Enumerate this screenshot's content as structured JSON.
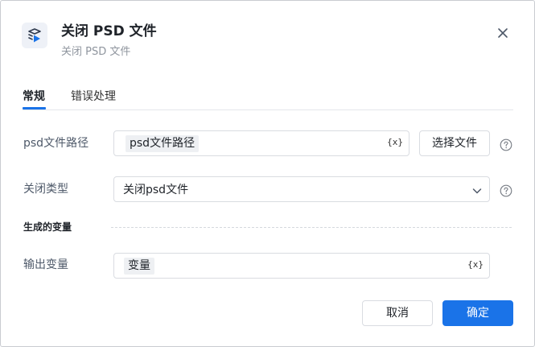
{
  "dialog": {
    "title": "关闭 PSD 文件",
    "subtitle": "关闭 PSD 文件",
    "icon": "psd-stack-icon",
    "close_icon": "close-icon"
  },
  "tabs": [
    {
      "label": "常规",
      "active": true
    },
    {
      "label": "错误处理",
      "active": false
    }
  ],
  "fields": {
    "psd_path": {
      "label": "psd文件路径",
      "value_chip": "psd文件路径",
      "var_button": "{x}",
      "select_file_button": "选择文件"
    },
    "close_type": {
      "label": "关闭类型",
      "selected": "关闭psd文件"
    }
  },
  "generated_vars": {
    "section_title": "生成的变量",
    "output": {
      "label": "输出变量",
      "value_chip": "变量",
      "var_button": "{x}"
    }
  },
  "footer": {
    "cancel_label": "取消",
    "ok_label": "确定"
  },
  "colors": {
    "accent": "#1a73e8",
    "border": "#d9dce1",
    "chip_bg": "#eef0f3"
  }
}
